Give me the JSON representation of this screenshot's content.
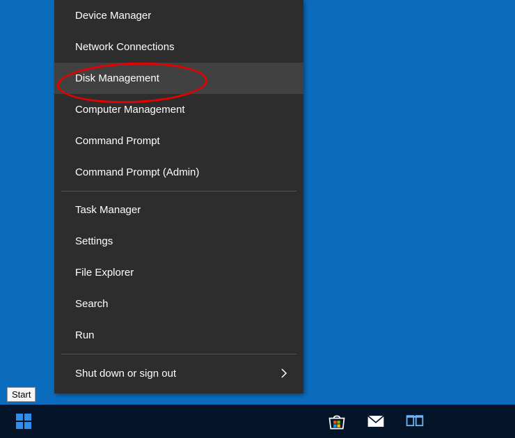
{
  "menu": {
    "items": [
      {
        "label": "Device Manager",
        "highlighted": false
      },
      {
        "label": "Network Connections",
        "highlighted": false
      },
      {
        "label": "Disk Management",
        "highlighted": true
      },
      {
        "label": "Computer Management",
        "highlighted": false
      },
      {
        "label": "Command Prompt",
        "highlighted": false
      },
      {
        "label": "Command Prompt (Admin)",
        "highlighted": false
      }
    ],
    "items2": [
      {
        "label": "Task Manager"
      },
      {
        "label": "Settings"
      },
      {
        "label": "File Explorer"
      },
      {
        "label": "Search"
      },
      {
        "label": "Run"
      }
    ],
    "items3": [
      {
        "label": "Shut down or sign out",
        "has_submenu": true
      }
    ]
  },
  "tooltip_start": "Start",
  "annotation": {
    "target_index": 2,
    "shape": "red-ellipse"
  },
  "taskbar": {
    "icons": [
      "start",
      "store",
      "mail",
      "task-view"
    ]
  },
  "colors": {
    "desktop": "#0b6cbd",
    "menu_bg": "#2d2d2d",
    "menu_highlight": "#414141",
    "taskbar": "#04152a",
    "annotation": "#e80000"
  }
}
